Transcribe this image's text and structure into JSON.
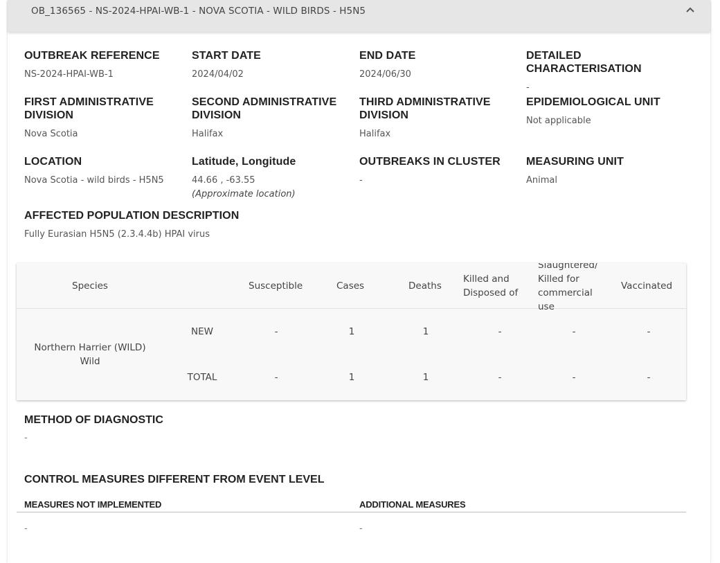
{
  "header": {
    "title": "OB_136565 - NS-2024-HPAI-WB-1 - NOVA SCOTIA - WILD BIRDS - H5N5"
  },
  "fields": {
    "outbreak_reference": {
      "label": "OUTBREAK REFERENCE",
      "value": "NS-2024-HPAI-WB-1"
    },
    "start_date": {
      "label": "START DATE",
      "value": "2024/04/02"
    },
    "end_date": {
      "label": "END DATE",
      "value": "2024/06/30"
    },
    "detailed_characterisation": {
      "label": "DETAILED CHARACTERISATION",
      "value": "-"
    },
    "first_admin": {
      "label": "FIRST ADMINISTRATIVE DIVISION",
      "value": "Nova Scotia"
    },
    "second_admin": {
      "label": "SECOND ADMINISTRATIVE DIVISION",
      "value": "Halifax"
    },
    "third_admin": {
      "label": "THIRD ADMINISTRATIVE DIVISION",
      "value": "Halifax"
    },
    "epi_unit": {
      "label": "EPIDEMIOLOGICAL UNIT",
      "value": "Not applicable"
    },
    "location": {
      "label": "LOCATION",
      "value": "Nova Scotia - wild birds - H5N5"
    },
    "lat_long": {
      "label": "Latitude, Longitude",
      "value": "44.66 , -63.55",
      "note": "(Approximate location)"
    },
    "outbreaks_cluster": {
      "label": "OUTBREAKS IN CLUSTER",
      "value": "-"
    },
    "measuring_unit": {
      "label": "MEASURING UNIT",
      "value": "Animal"
    },
    "affected_population": {
      "label": "AFFECTED POPULATION DESCRIPTION",
      "value": "Fully Eurasian H5N5 (2.3.4.4b) HPAI virus"
    }
  },
  "table": {
    "headers": {
      "species": "Species",
      "susceptible": "Susceptible",
      "cases": "Cases",
      "deaths": "Deaths",
      "killed": "Killed and Disposed of",
      "slaughtered": "Slaughtered/ Killed for commercial use",
      "vaccinated": "Vaccinated"
    },
    "species_name": "Northern Harrier (WILD)",
    "species_type": "Wild",
    "rows": [
      {
        "type": "NEW",
        "susceptible": "-",
        "cases": "1",
        "deaths": "1",
        "killed": "-",
        "slaughtered": "-",
        "vaccinated": "-"
      },
      {
        "type": "TOTAL",
        "susceptible": "-",
        "cases": "1",
        "deaths": "1",
        "killed": "-",
        "slaughtered": "-",
        "vaccinated": "-"
      }
    ]
  },
  "diagnostic": {
    "label": "METHOD OF DIAGNOSTIC",
    "value": "-"
  },
  "control": {
    "label": "CONTROL MEASURES DIFFERENT FROM EVENT LEVEL",
    "not_implemented_label": "MEASURES NOT IMPLEMENTED",
    "not_implemented_value": "-",
    "additional_label": "ADDITIONAL MEASURES",
    "additional_value": "-"
  }
}
